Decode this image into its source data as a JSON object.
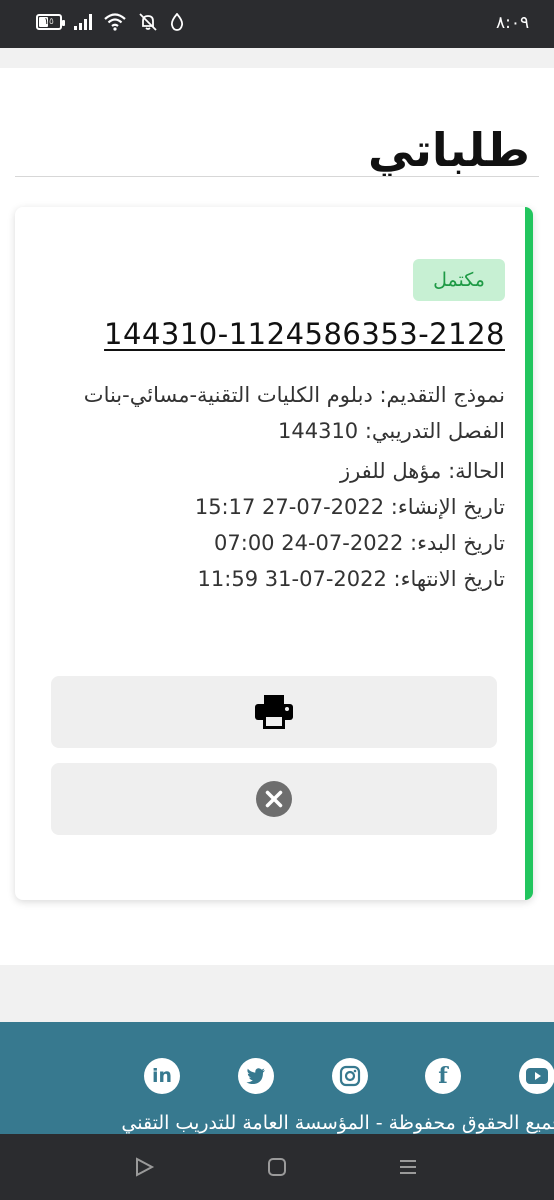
{
  "status_bar": {
    "time": "٨:٠٩",
    "battery_level": "١٥",
    "icons": [
      "battery-icon",
      "signal-icon",
      "wifi-icon",
      "mute-icon",
      "data-saver-icon"
    ]
  },
  "page": {
    "title": "طلباتي"
  },
  "application": {
    "status_badge": "مكتمل",
    "number": "144310-1124586353-2128",
    "form": "نموذج التقديم: دبلوم الكليات التقنية-مسائي-بنات",
    "semester": "الفصل التدريبي: 144310",
    "state": "الحالة: مؤهل للفرز",
    "created": "تاريخ الإنشاء: 2022-07-27 15:17",
    "start": "تاريخ البدء: 2022-07-24 07:00",
    "end": "تاريخ الانتهاء: 2022-07-31 11:59"
  },
  "actions": {
    "print_icon": "printer-icon",
    "cancel_icon": "close-circle-icon"
  },
  "footer": {
    "social": [
      "youtube-icon",
      "facebook-icon",
      "instagram-icon",
      "twitter-icon",
      "linkedin-icon"
    ],
    "copyright": "جميع الحقوق محفوظة - المؤسسة العامة للتدريب التقني"
  },
  "colors": {
    "accent": "#22c55e",
    "badge_bg": "#c7f0d3",
    "badge_text": "#1e9a45",
    "footer": "#37798f",
    "bars": "#2b2c2f"
  }
}
